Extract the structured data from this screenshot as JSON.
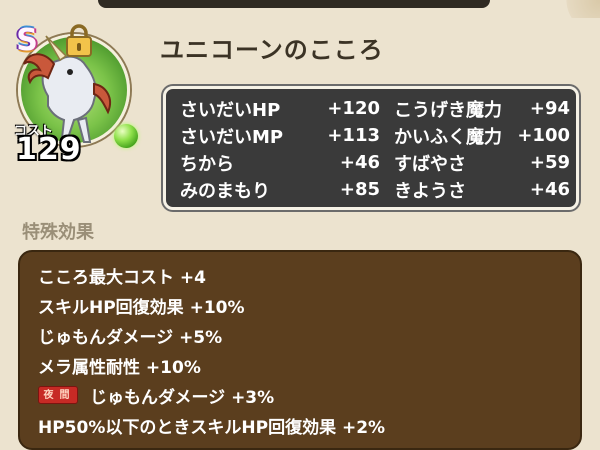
{
  "card": {
    "rank": "S",
    "title": "ユニコーンのこころ",
    "cost_label": "コスト",
    "cost": "129",
    "portrait_icon": "unicorn-icon"
  },
  "stats": [
    {
      "name": "さいだいHP",
      "value": "+120"
    },
    {
      "name": "こうげき魔力",
      "value": "+94"
    },
    {
      "name": "さいだいMP",
      "value": "+113"
    },
    {
      "name": "かいふく魔力",
      "value": "+100"
    },
    {
      "name": "ちから",
      "value": "+46"
    },
    {
      "name": "すばやさ",
      "value": "+59"
    },
    {
      "name": "みのまもり",
      "value": "+85"
    },
    {
      "name": "きようさ",
      "value": "+46"
    }
  ],
  "special": {
    "heading": "特殊効果",
    "night_badge": "夜間",
    "effects": [
      "こころ最大コスト +4",
      "スキルHP回復効果 +10%",
      "じゅもんダメージ +5%",
      "メラ属性耐性 +10%",
      "じゅもんダメージ +3%",
      "HP50%以下のときスキルHP回復効果 +2%"
    ]
  },
  "colors": {
    "panel_dark": "#3a3a3a",
    "effects_brown": "#5b3e1e",
    "background": "#ece3cf",
    "night_red": "#c72a25"
  }
}
